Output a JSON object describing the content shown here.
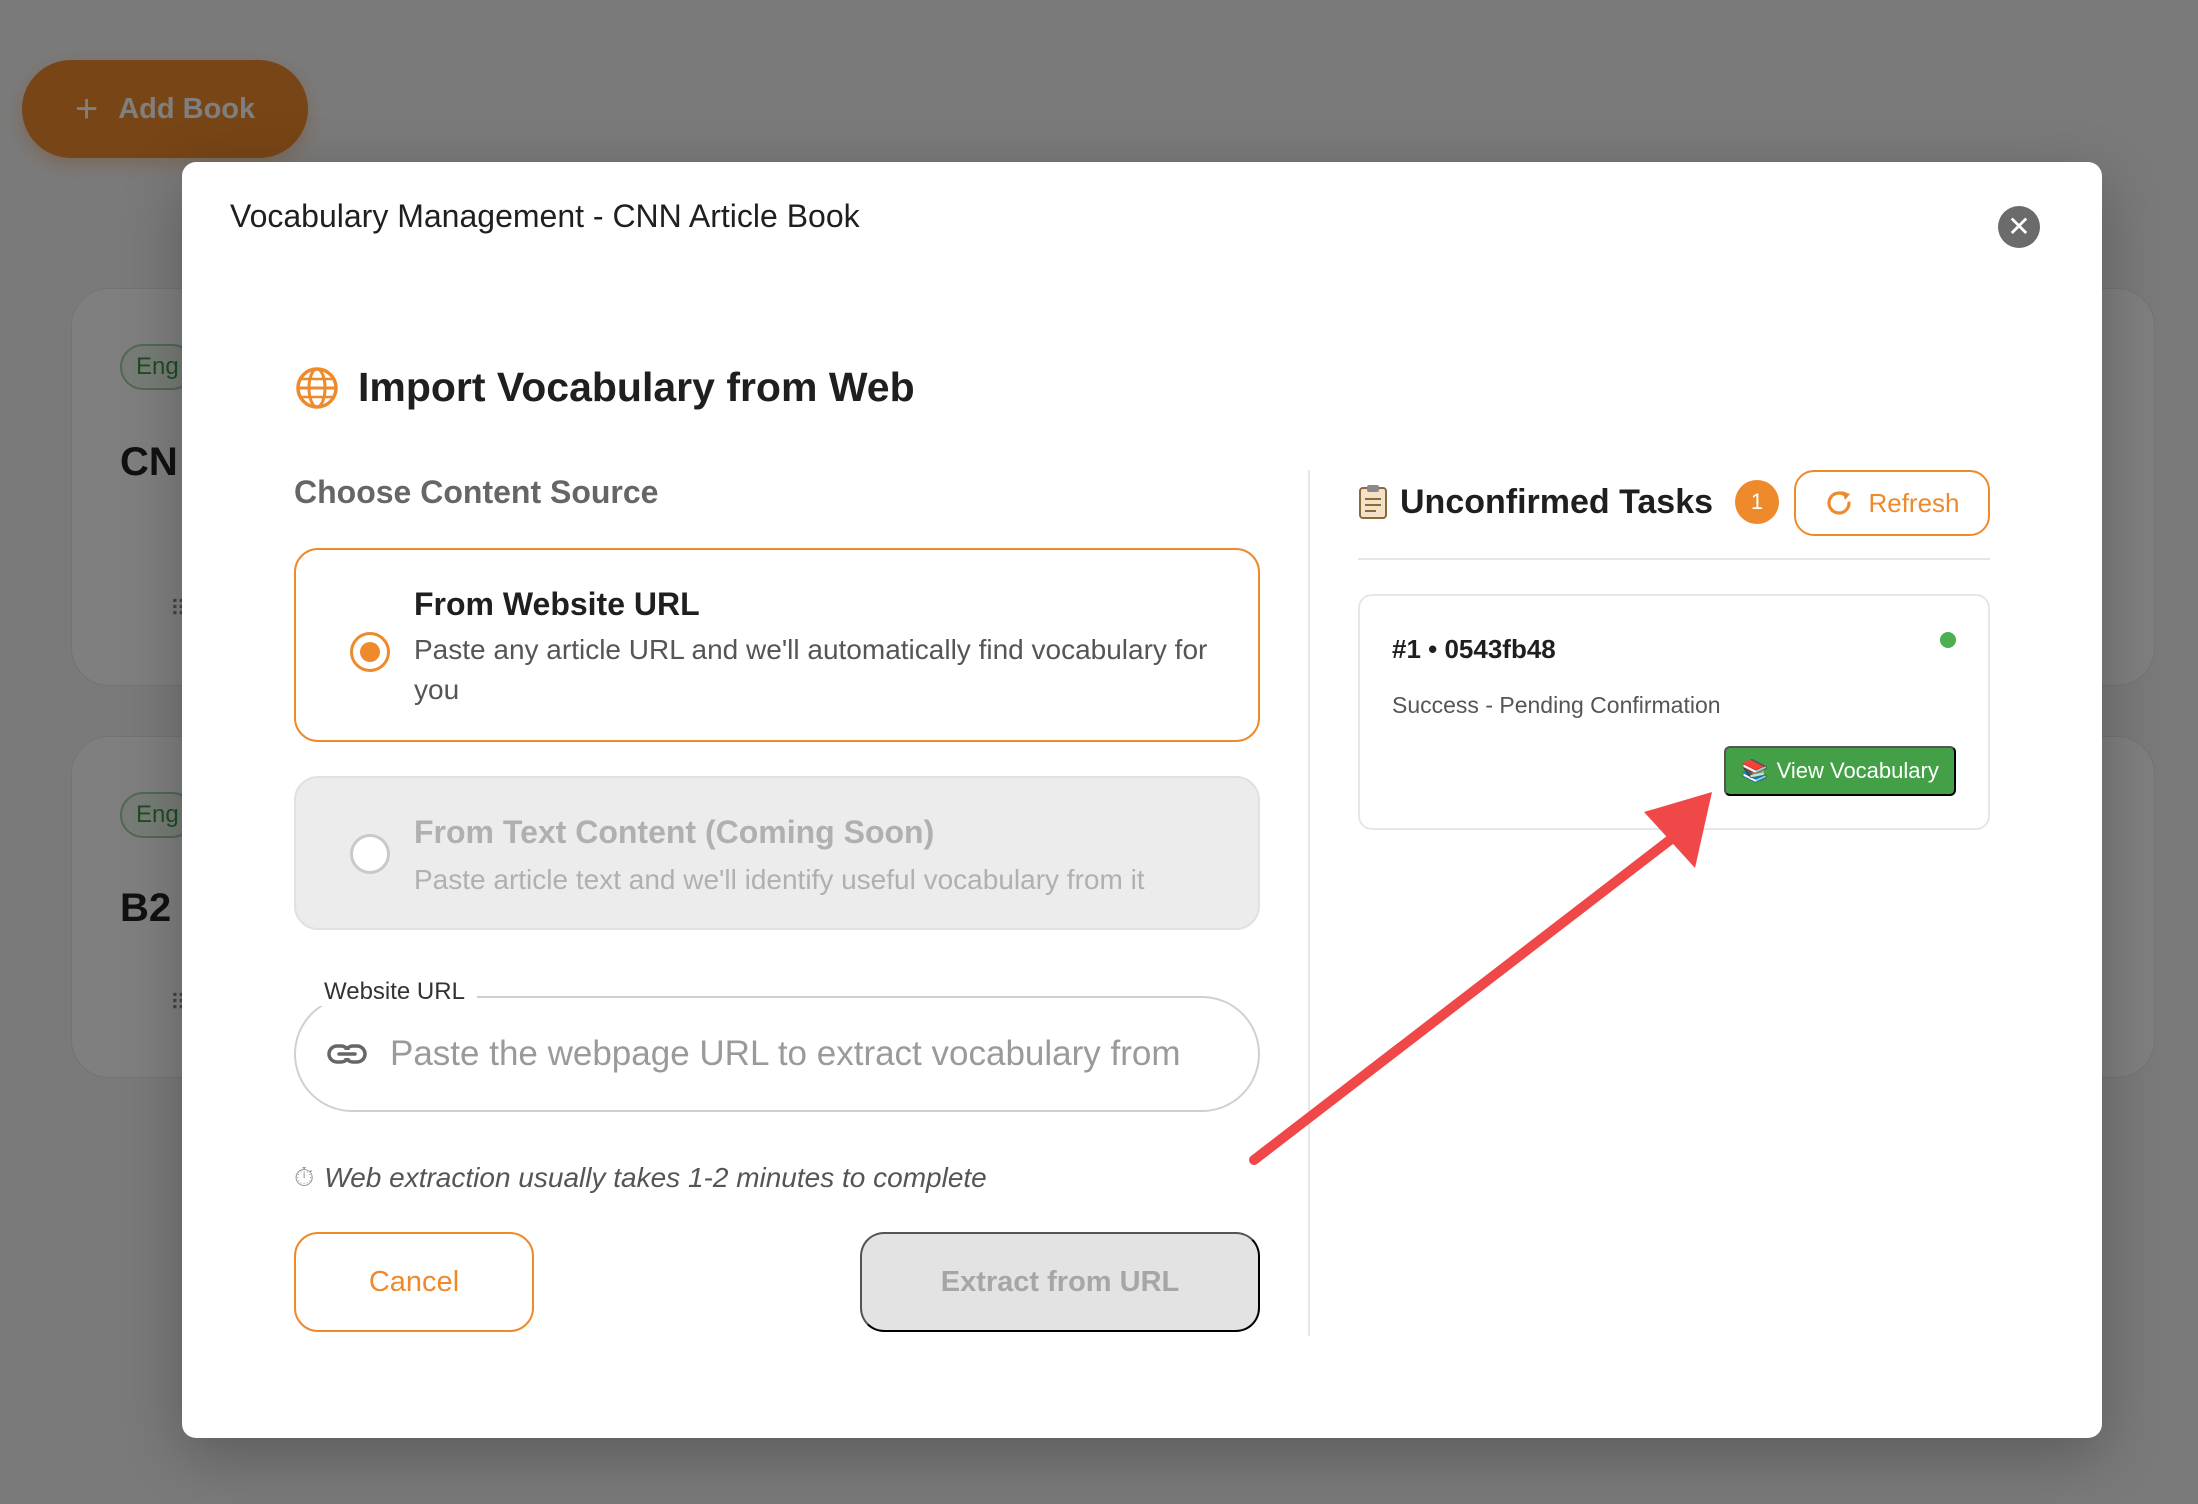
{
  "background": {
    "add_book_label": "Add Book",
    "cards": [
      {
        "tag": "Eng",
        "title": "CN",
        "dots": "⠿"
      },
      {
        "tag": "Eng",
        "title": "B2",
        "dots": "⠿"
      }
    ]
  },
  "modal": {
    "title": "Vocabulary Management - CNN Article Book",
    "section_title": "Import Vocabulary from Web",
    "choose_label": "Choose Content Source",
    "options": [
      {
        "title": "From Website URL",
        "description": "Paste any article URL and we'll automatically find vocabulary for you",
        "selected": true
      },
      {
        "title": "From Text Content (Coming Soon)",
        "description": "Paste article text and we'll identify useful vocabulary from it",
        "selected": false
      }
    ],
    "url_field": {
      "label": "Website URL",
      "placeholder": "Paste the webpage URL to extract vocabulary from",
      "value": ""
    },
    "hint": "Web extraction usually takes 1-2 minutes to complete",
    "cancel_label": "Cancel",
    "extract_label": "Extract from URL"
  },
  "tasks_panel": {
    "title": "Unconfirmed Tasks",
    "count": "1",
    "refresh_label": "Refresh",
    "tasks": [
      {
        "id": "#1 • 0543fb48",
        "status": "Success - Pending Confirmation",
        "status_color": "#4caf50",
        "action_label": "View Vocabulary"
      }
    ]
  },
  "colors": {
    "accent": "#ee8a2c",
    "success": "#43a047",
    "annotation_arrow": "#f04848"
  },
  "icons": [
    "plus-icon",
    "close-icon",
    "globe-icon",
    "radio-selected",
    "radio-unselected",
    "link-icon",
    "timer-icon",
    "clipboard-icon",
    "refresh-icon",
    "books-icon"
  ]
}
